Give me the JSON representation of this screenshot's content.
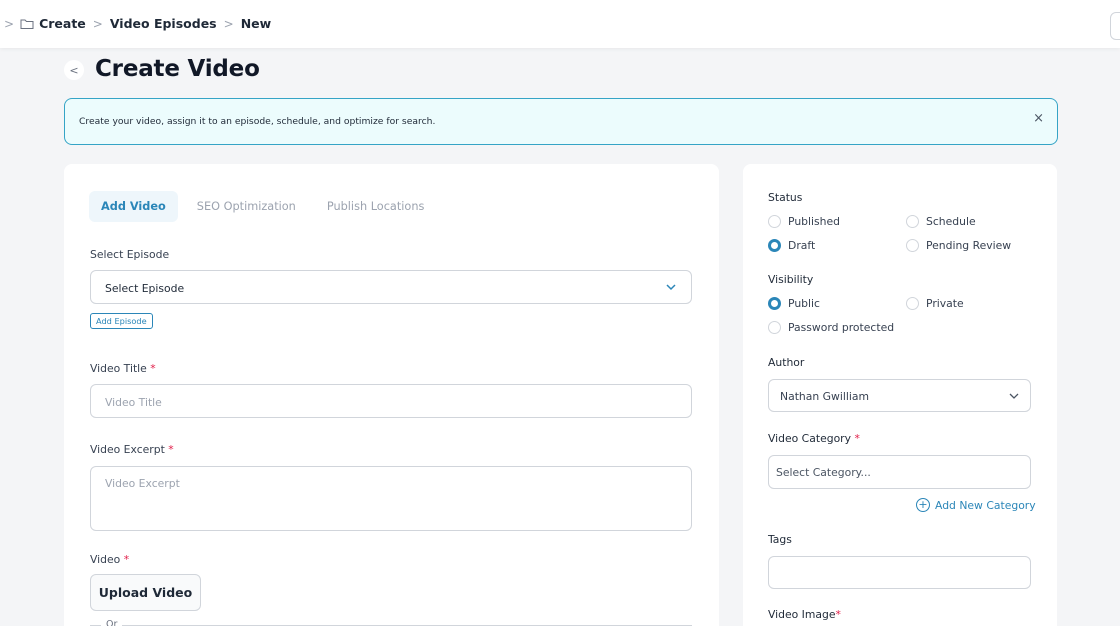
{
  "breadcrumb": {
    "items": [
      "Create",
      "Video Episodes",
      "New"
    ]
  },
  "page": {
    "title": "Create Video"
  },
  "notice": {
    "text": "Create your video, assign it to an episode, schedule, and optimize for search.",
    "close": "×"
  },
  "tabs": [
    {
      "label": "Add Video",
      "active": true
    },
    {
      "label": "SEO Optimization",
      "active": false
    },
    {
      "label": "Publish Locations",
      "active": false
    }
  ],
  "form": {
    "episode_label": "Select Episode",
    "episode_value": "Select Episode",
    "add_episode": "Add Episode",
    "title_label": "Video Title",
    "title_placeholder": "Video Title",
    "excerpt_label": "Video Excerpt",
    "excerpt_placeholder": "Video Excerpt",
    "video_label": "Video",
    "upload_label": "Upload Video",
    "or_text": "Or",
    "required_mark": "*"
  },
  "sidebar": {
    "status_label": "Status",
    "status_options": [
      {
        "label": "Published",
        "selected": false
      },
      {
        "label": "Schedule",
        "selected": false
      },
      {
        "label": "Draft",
        "selected": true
      },
      {
        "label": "Pending Review",
        "selected": false
      }
    ],
    "visibility_label": "Visibility",
    "visibility_options": [
      {
        "label": "Public",
        "selected": true
      },
      {
        "label": "Private",
        "selected": false
      },
      {
        "label": "Password protected",
        "selected": false
      }
    ],
    "author_label": "Author",
    "author_value": "Nathan Gwilliam",
    "category_label": "Video Category",
    "category_placeholder": "Select Category...",
    "add_category": "Add New Category",
    "tags_label": "Tags",
    "image_label": "Video Image"
  },
  "colors": {
    "accent": "#2b86b8",
    "notice_bg": "#ecfcfd",
    "notice_border": "#35a4c6",
    "required": "#e11d48"
  }
}
